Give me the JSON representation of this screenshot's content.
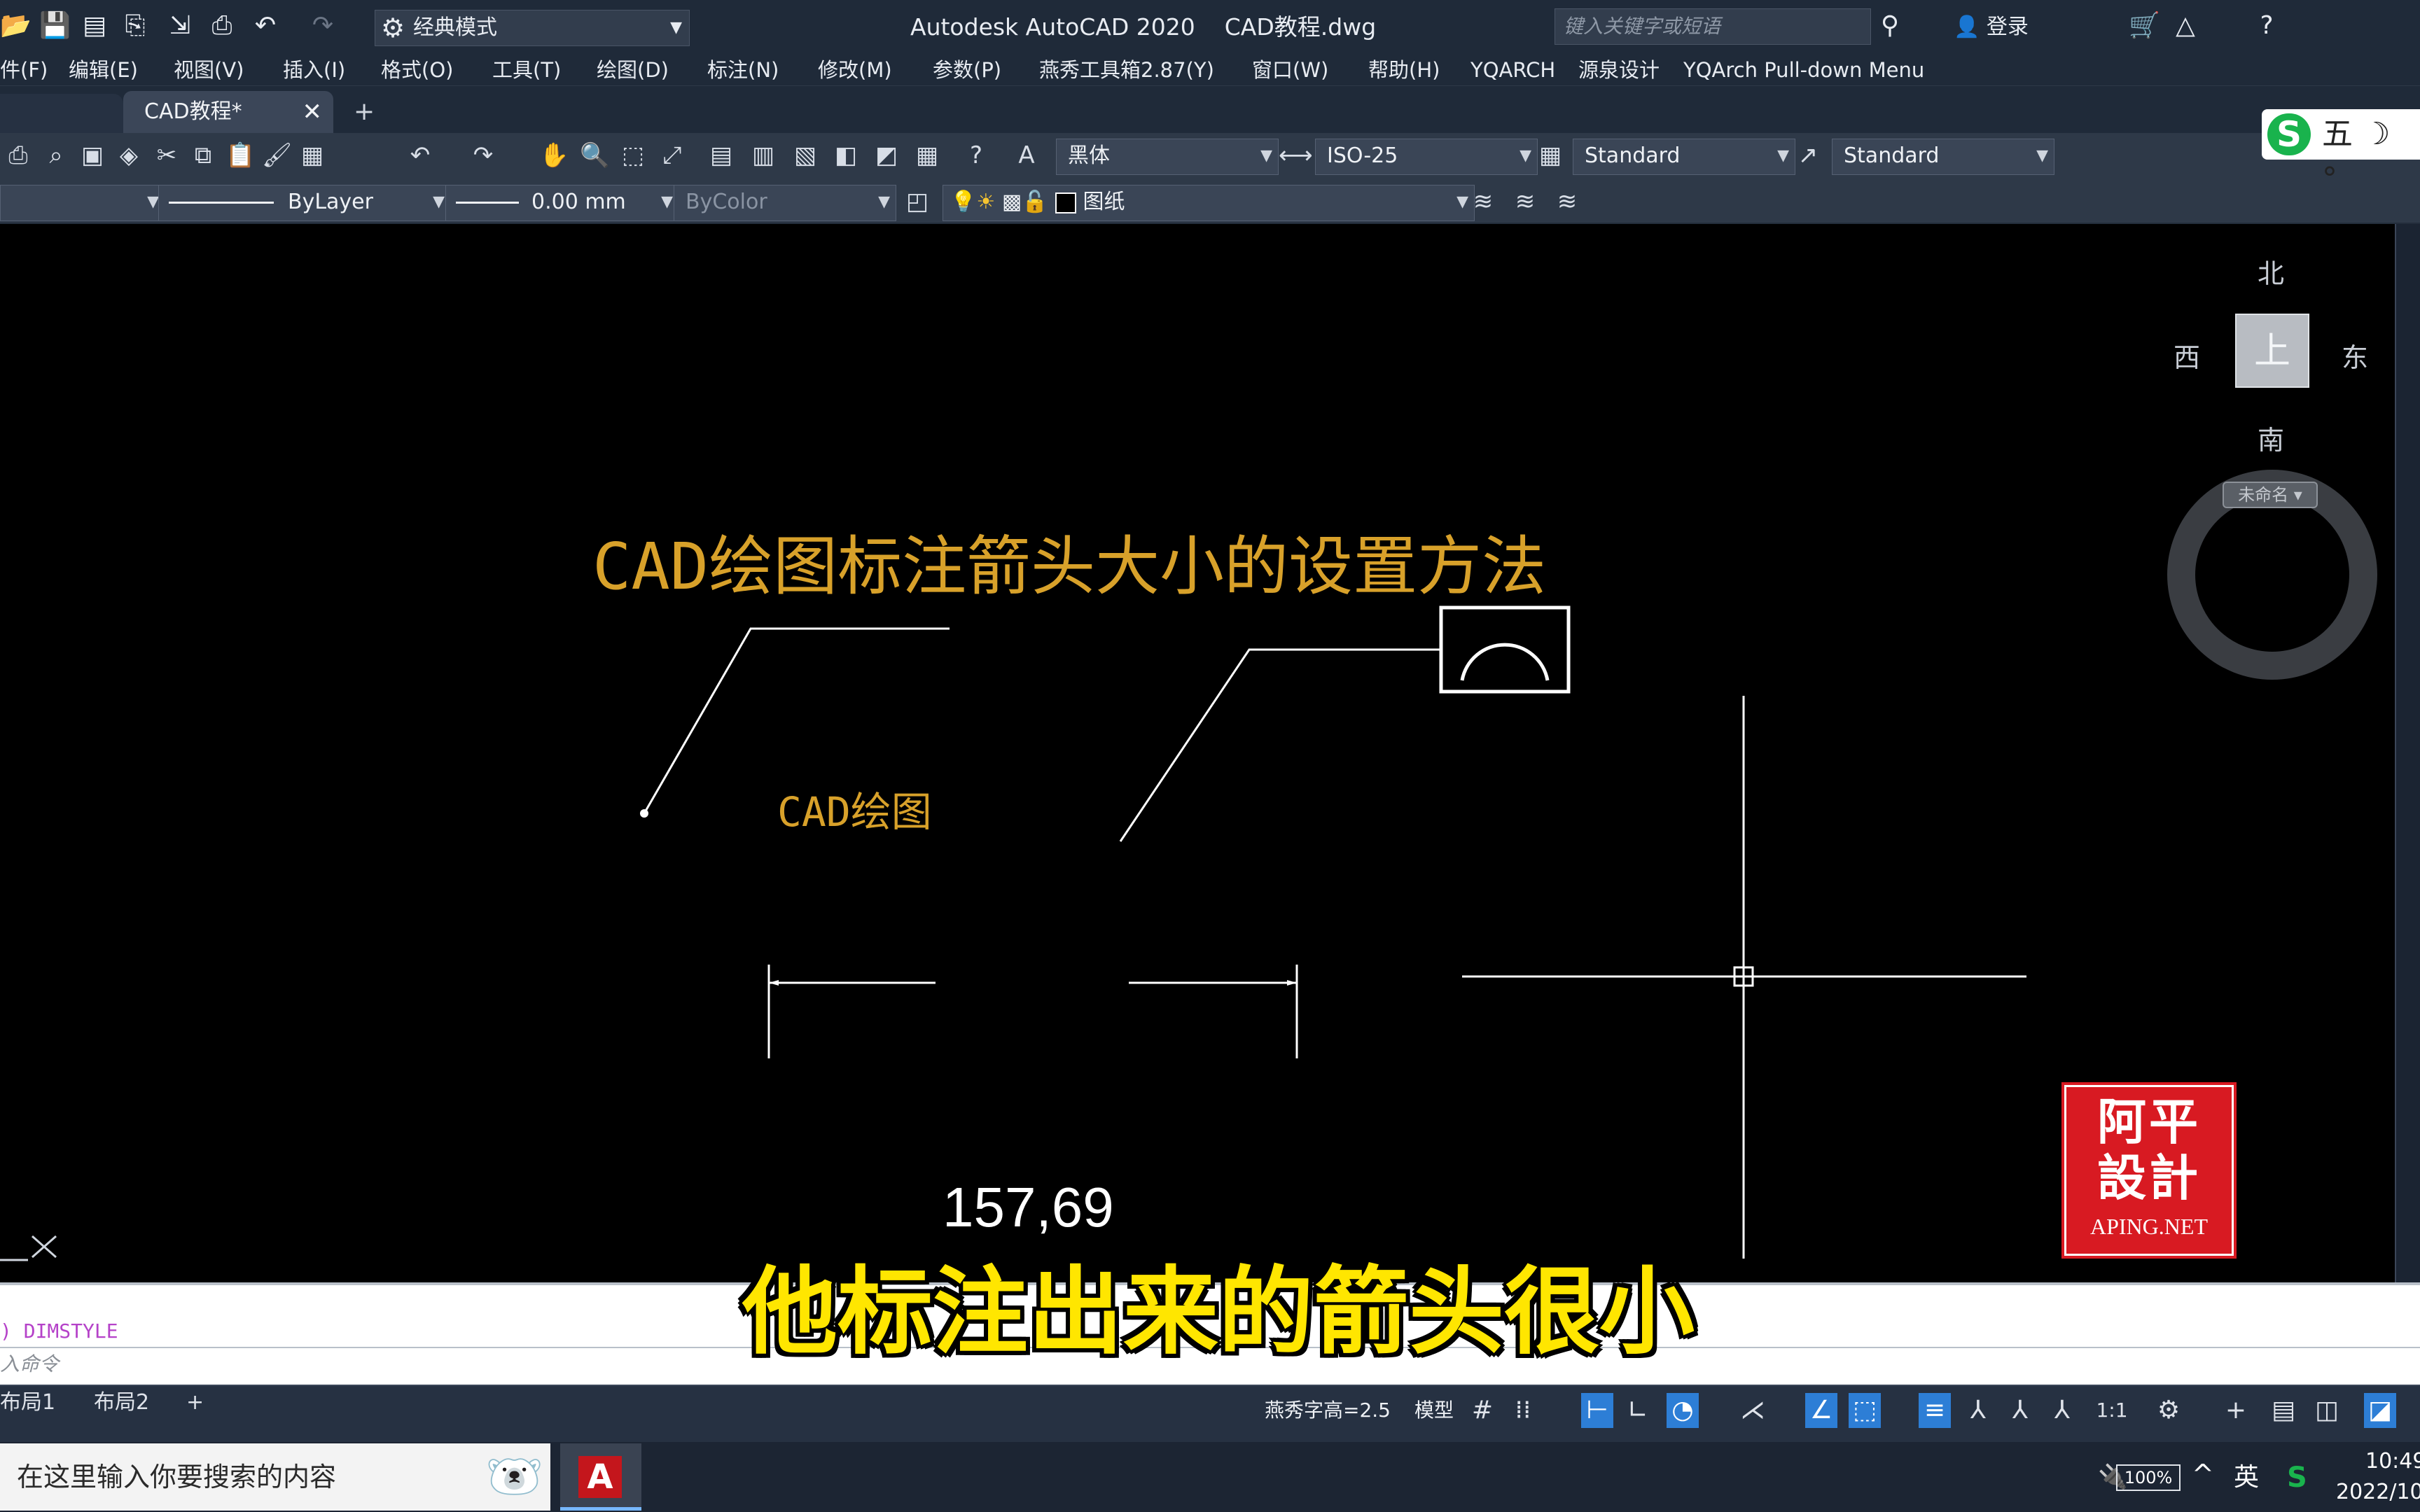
{
  "titlebar": {
    "workspace": "经典模式",
    "app_name": "Autodesk AutoCAD 2020",
    "file_name": "CAD教程.dwg",
    "search_placeholder": "键入关键字或短语",
    "login": "登录"
  },
  "menu": [
    "件(F)",
    "编辑(E)",
    "视图(V)",
    "插入(I)",
    "格式(O)",
    "工具(T)",
    "绘图(D)",
    "标注(N)",
    "修改(M)",
    "参数(P)",
    "燕秀工具箱2.87(Y)",
    "窗口(W)",
    "帮助(H)",
    "YQARCH",
    "源泉设计",
    "YQArch Pull-down Menu"
  ],
  "tabs": {
    "active": "CAD教程*"
  },
  "toolbar": {
    "text_style": "黑体",
    "dim_style": "ISO-25",
    "table_style": "Standard",
    "multileader_style": "Standard",
    "linetype": "ByLayer",
    "lineweight": "0.00 mm",
    "plot_style": "ByColor",
    "layer": "图纸"
  },
  "ime": {
    "label": "五"
  },
  "drawing": {
    "title": "CAD绘图标注箭头大小的设置方法",
    "mtext": "CAD绘图",
    "dimension": "157,69"
  },
  "viewcube": {
    "north": "北",
    "south": "南",
    "east": "东",
    "west": "西",
    "face": "上",
    "view_name": "未命名"
  },
  "watermark": {
    "seal": "阿平 設計",
    "site": "APING.NET"
  },
  "command": {
    "history": "DIMSTYLE",
    "prompt": "入命令"
  },
  "subtitle": "他标注出来的箭头很小",
  "layout_tabs": [
    "布局1",
    "布局2"
  ],
  "status": {
    "text_height": "燕秀字高=2.5",
    "model": "模型",
    "scale": "1:1"
  },
  "taskbar": {
    "search": "在这里输入你要搜索的内容",
    "battery": "100%",
    "lang": "英",
    "time": "10:49",
    "date": "2022/10"
  }
}
